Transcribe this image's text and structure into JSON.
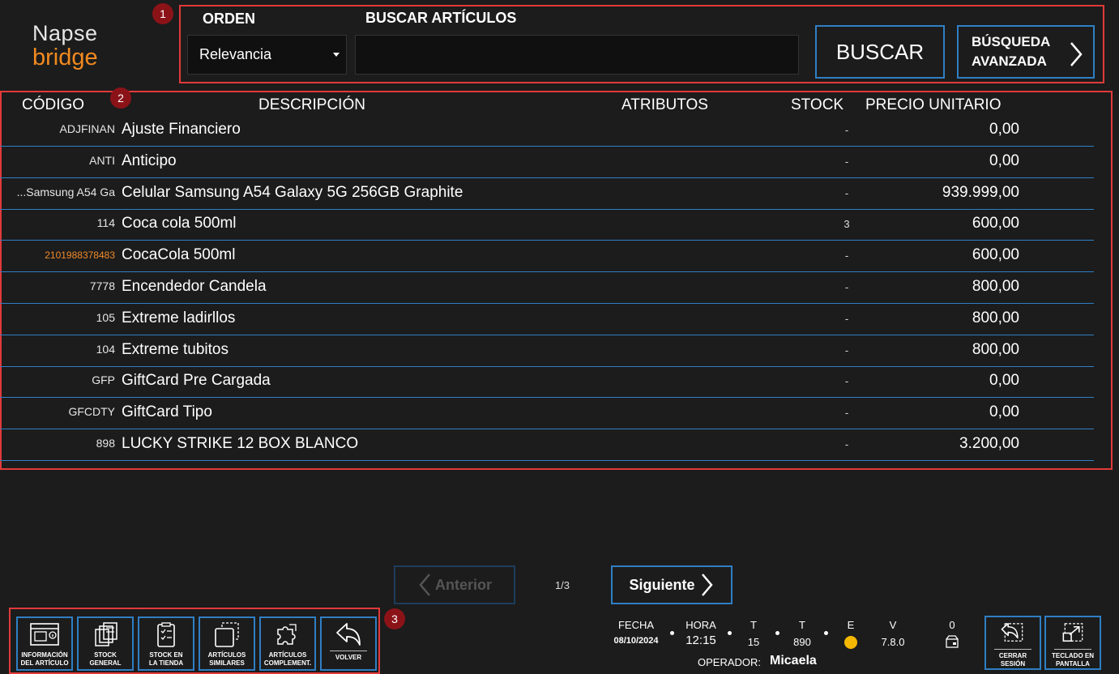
{
  "logo": {
    "line1": "Napse",
    "line2": "bridge"
  },
  "annotations": [
    "1",
    "2",
    "3"
  ],
  "search": {
    "order_label": "ORDEN",
    "order_value": "Relevancia",
    "search_label": "BUSCAR ARTÍCULOS",
    "search_value": "",
    "search_button": "BUSCAR",
    "advanced_line1": "BÚSQUEDA",
    "advanced_line2": "AVANZADA"
  },
  "table": {
    "headers": {
      "code": "CÓDIGO",
      "description": "DESCRIPCIÓN",
      "attributes": "ATRIBUTOS",
      "stock": "STOCK",
      "price": "PRECIO UNITARIO"
    },
    "rows": [
      {
        "code": "ADJFINAN",
        "description": "Ajuste Financiero",
        "stock": "-",
        "price": "0,00"
      },
      {
        "code": "ANTI",
        "description": "Anticipo",
        "stock": "-",
        "price": "0,00"
      },
      {
        "code": "Samsung A54 Ga...",
        "description": "Celular Samsung A54 Galaxy 5G 256GB Graphite",
        "stock": "-",
        "price": "939.999,00"
      },
      {
        "code": "114",
        "description": "Coca cola 500ml",
        "stock": "3",
        "price": "600,00"
      },
      {
        "code": "2101988378483",
        "description": "CocaCola 500ml",
        "stock": "-",
        "price": "600,00"
      },
      {
        "code": "7778",
        "description": "Encendedor Candela",
        "stock": "-",
        "price": "800,00"
      },
      {
        "code": "105",
        "description": "Extreme ladirllos",
        "stock": "-",
        "price": "800,00"
      },
      {
        "code": "104",
        "description": "Extreme tubitos",
        "stock": "-",
        "price": "800,00"
      },
      {
        "code": "GFP",
        "description": "GiftCard Pre Cargada",
        "stock": "-",
        "price": "0,00"
      },
      {
        "code": "GFCDTY",
        "description": "GiftCard Tipo",
        "stock": "-",
        "price": "0,00"
      },
      {
        "code": "898",
        "description": "LUCKY STRIKE 12 BOX BLANCO",
        "stock": "-",
        "price": "3.200,00"
      }
    ]
  },
  "pagination": {
    "prev": "Anterior",
    "page": "1/3",
    "next": "Siguiente"
  },
  "tools": [
    {
      "label": "INFORMACIÓN DEL ARTÍCULO",
      "icon": "article-info-icon"
    },
    {
      "label": "STOCK GENERAL",
      "icon": "stock-general-icon"
    },
    {
      "label": "STOCK EN LA TIENDA",
      "icon": "store-stock-icon"
    },
    {
      "label": "ARTÍCULOS SIMILARES",
      "icon": "similar-articles-icon"
    },
    {
      "label": "ARTÍCULOS COMPLEMENT.",
      "icon": "puzzle-icon"
    },
    {
      "label": "VOLVER",
      "icon": "back-arrow-icon"
    }
  ],
  "status": {
    "fecha_label": "FECHA",
    "fecha": "08/10/2024",
    "hora_label": "HORA",
    "hora": "12:15",
    "t1_label": "T",
    "t1": "15",
    "t2_label": "T",
    "t2": "890",
    "e_label": "E",
    "v_label": "V",
    "v": "7.8.0",
    "count": "0",
    "operador_label": "OPERADOR:",
    "operador": "Micaela",
    "status_color": "#f5b800"
  },
  "session": {
    "logout": "CERRAR SESIÓN",
    "keyboard": "TECLADO EN PANTALLA"
  },
  "colors": {
    "accent": "#2f7fc4",
    "brand_orange": "#f28a1f",
    "annotation": "#e23a3a"
  }
}
